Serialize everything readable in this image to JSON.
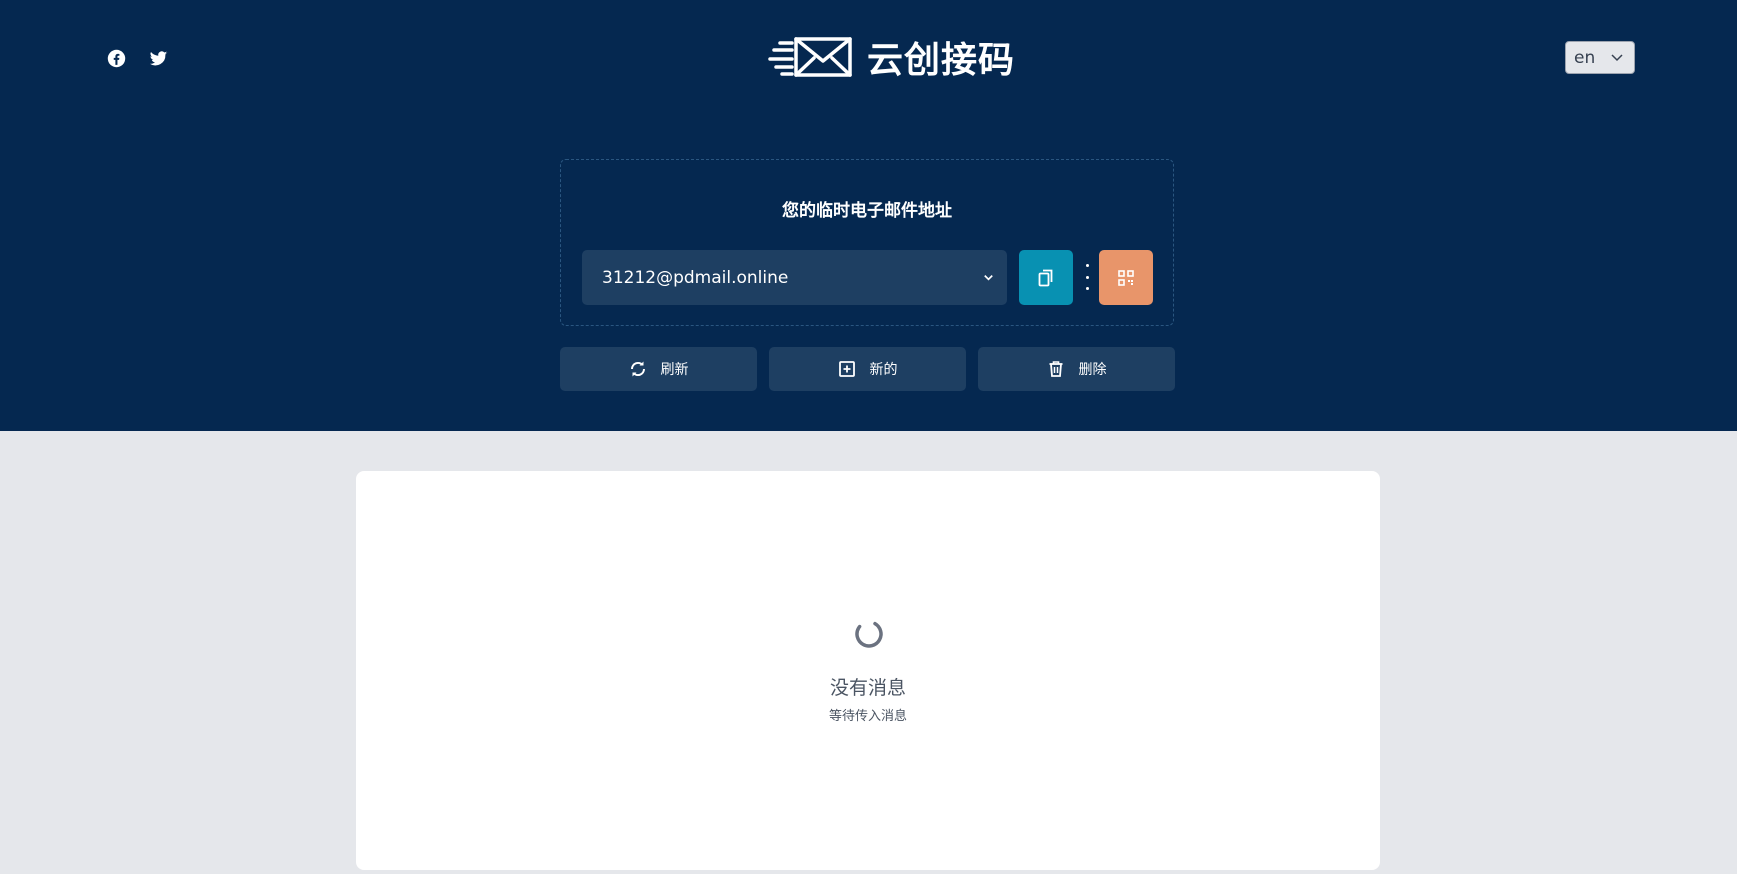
{
  "header": {
    "brand_name": "云创接码",
    "language": "en",
    "email_label": "您的临时电子邮件地址",
    "email_value": "31212@pdmail.online"
  },
  "actions": {
    "refresh_label": "刷新",
    "new_label": "新的",
    "delete_label": "删除"
  },
  "inbox": {
    "empty_title": "没有消息",
    "empty_subtitle": "等待传入消息"
  },
  "colors": {
    "header_bg": "#052850",
    "copy_button": "#0891b2",
    "qr_button": "#e8956a",
    "page_bg": "#e5e7eb"
  }
}
